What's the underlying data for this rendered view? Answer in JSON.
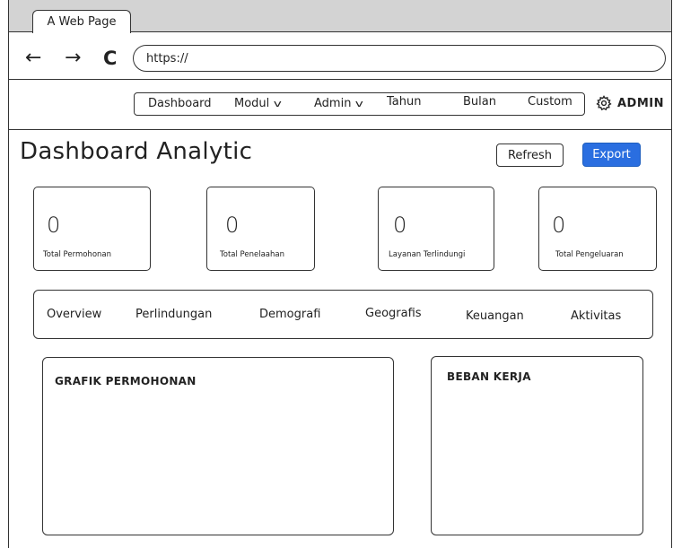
{
  "browser": {
    "tab_title": "A Web Page",
    "back_glyph": "←",
    "forward_glyph": "→",
    "reload_glyph": "C",
    "url": "https://"
  },
  "menu": {
    "items": [
      {
        "label": "Dashboard"
      },
      {
        "label": "Modul",
        "dropdown": true
      },
      {
        "label": "Admin",
        "dropdown": true
      },
      {
        "label": "Tahun"
      },
      {
        "label": "Bulan"
      },
      {
        "label": "Custom"
      }
    ],
    "chevron_glyph": "v"
  },
  "user": {
    "icon": "gear-icon",
    "label": "ADMIN"
  },
  "page": {
    "title": "Dashboard Analytic",
    "refresh_label": "Refresh",
    "export_label": "Export"
  },
  "stats": [
    {
      "value": "0",
      "label": "Total Permohonan"
    },
    {
      "value": "0",
      "label": "Total Penelaahan"
    },
    {
      "value": "0",
      "label": "Layanan Terlindungi"
    },
    {
      "value": "0",
      "label": "Total Pengeluaran"
    }
  ],
  "tabs": [
    "Overview",
    "Perlindungan",
    "Demografi",
    "Geografis",
    "Keuangan",
    "Aktivitas"
  ],
  "panels": {
    "grafik_title": "GRAFIK PERMOHONAN",
    "beban_title": "BEBAN KERJA"
  },
  "colors": {
    "accent": "#2a6ee0",
    "tabstrip": "#d3d3d3"
  }
}
